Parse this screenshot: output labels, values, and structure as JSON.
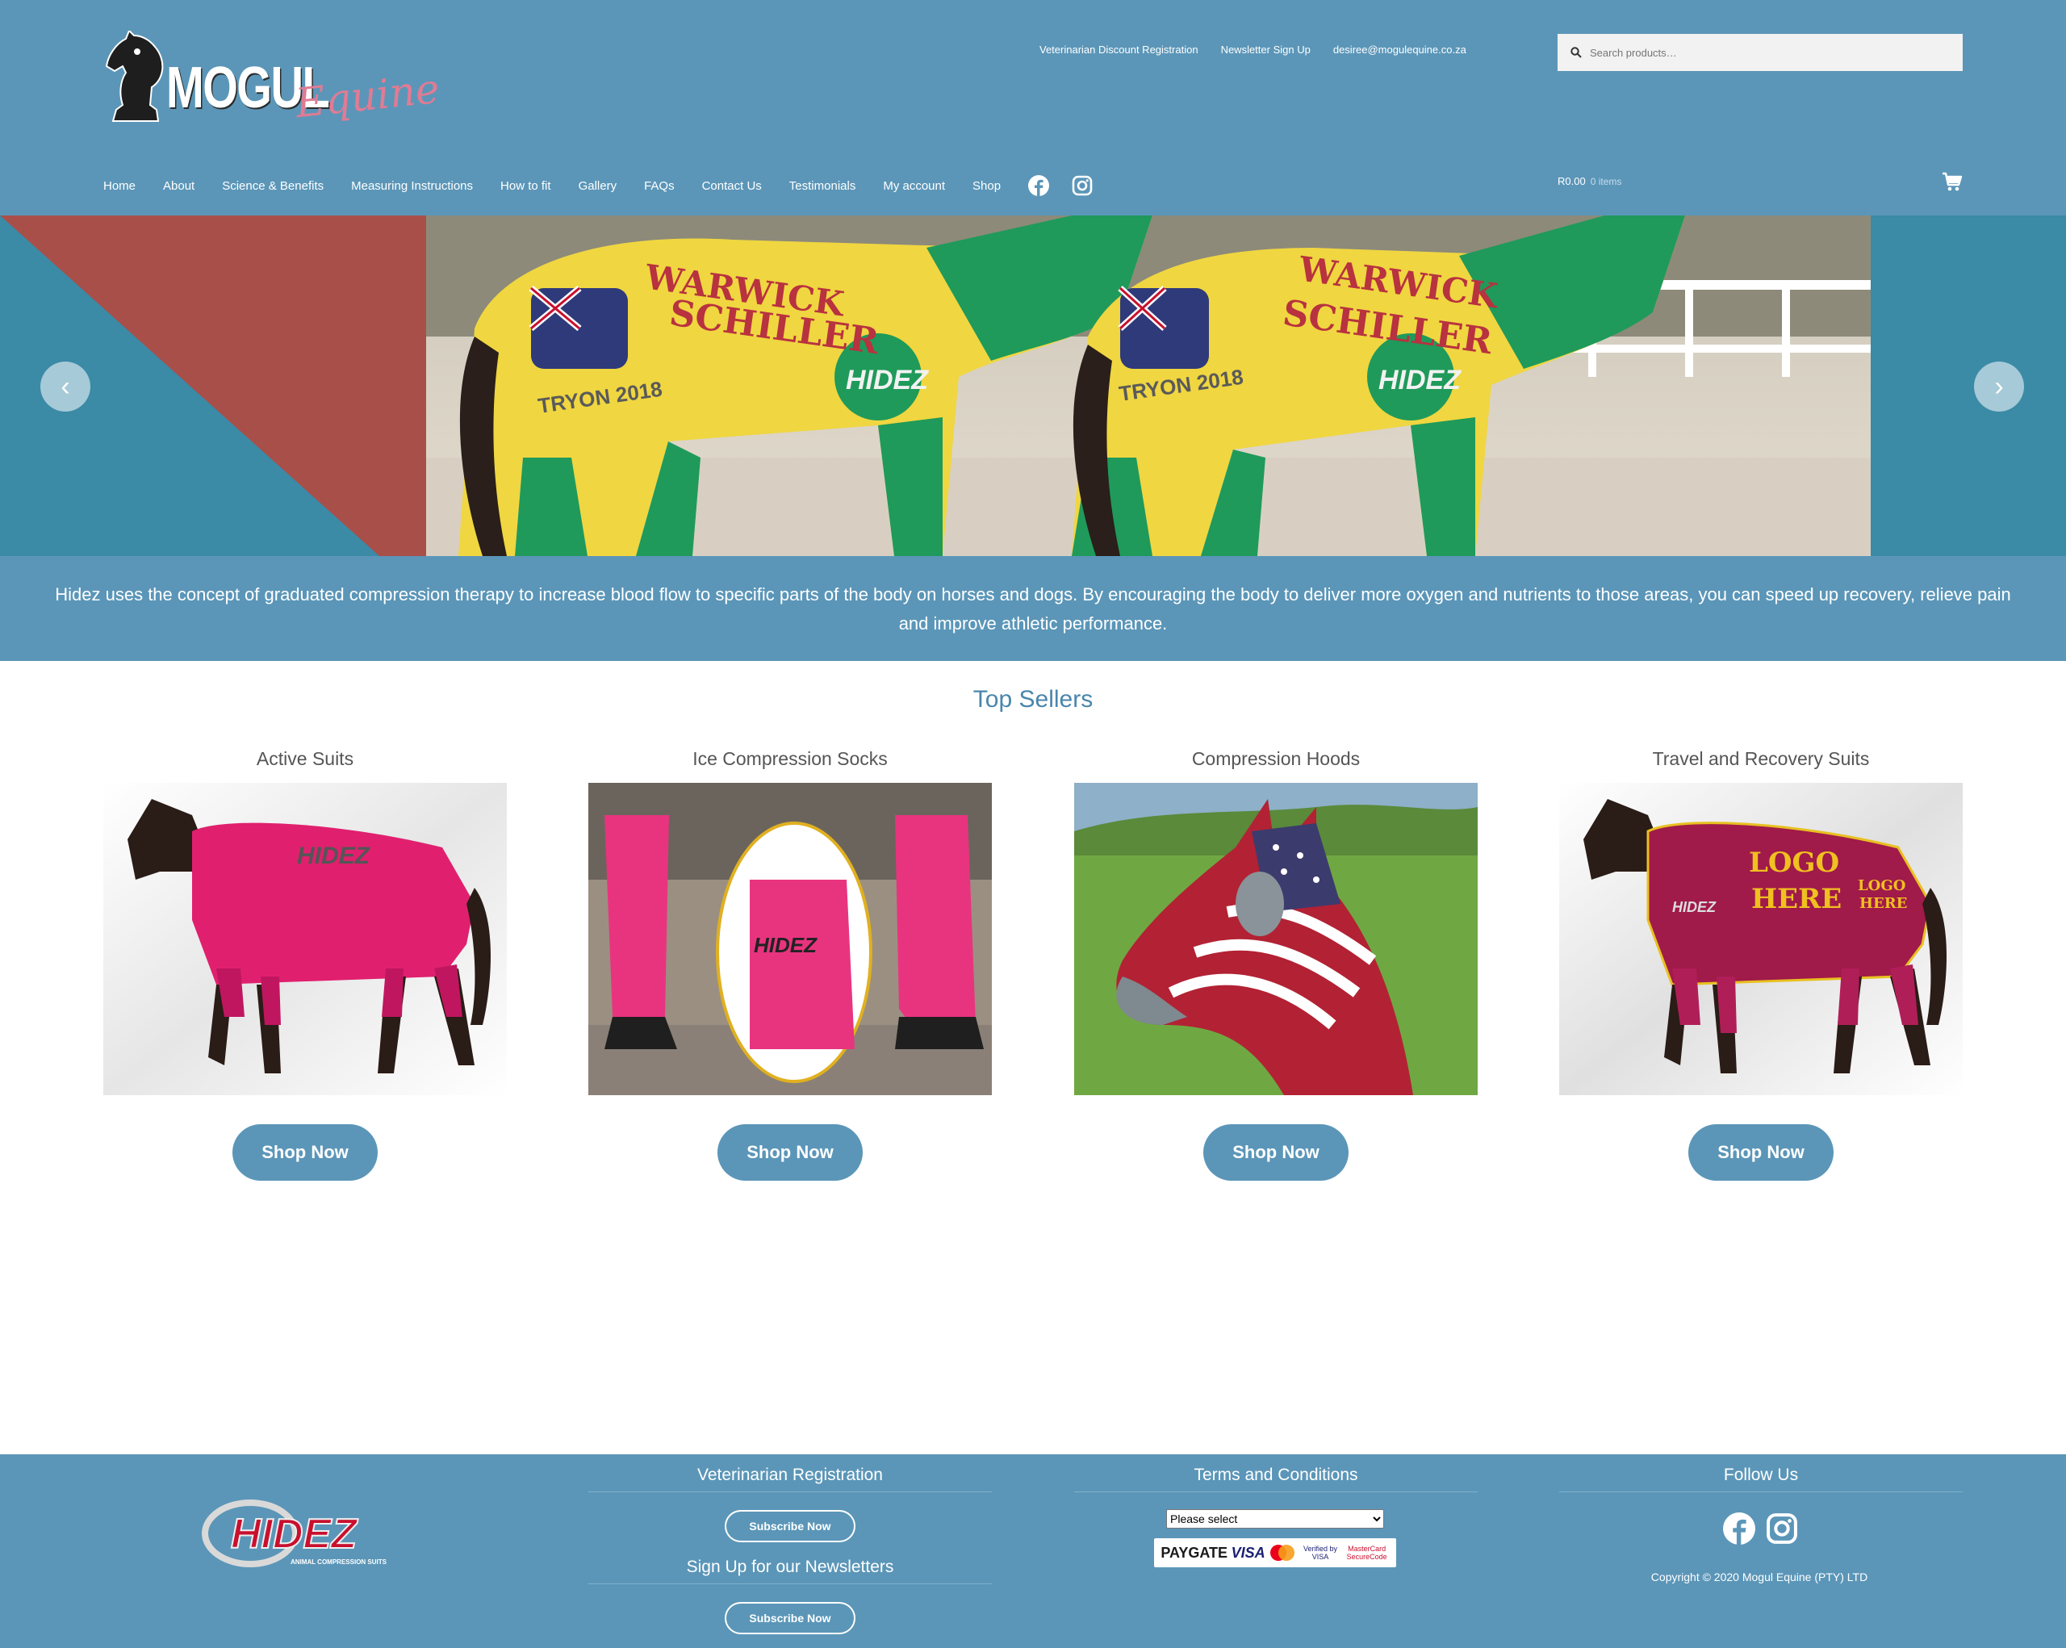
{
  "brand": {
    "logo_text": "MOGUL",
    "logo_script": "Equine"
  },
  "top_links": [
    "Veterinarian Discount Registration",
    "Newsletter Sign Up",
    "desiree@mogulequine.co.za"
  ],
  "search": {
    "placeholder": "Search products…"
  },
  "nav": {
    "items": [
      "Home",
      "About",
      "Science & Benefits",
      "Measuring Instructions",
      "How to fit",
      "Gallery",
      "FAQs",
      "Contact Us",
      "Testimonials",
      "My account",
      "Shop"
    ],
    "social_icons": [
      "facebook-icon",
      "instagram-icon"
    ]
  },
  "cart": {
    "amount": "R0.00",
    "items": "0 items",
    "icon": "cart-icon"
  },
  "hero": {
    "banner_text": [
      "WARWICK",
      "SCHILLER",
      "TRYON 2018",
      "HIDEZ"
    ],
    "prev_icon": "chevron-left-icon",
    "next_icon": "chevron-right-icon"
  },
  "intro": "Hidez uses the concept of graduated compression therapy to increase blood flow to specific parts of the body on horses and dogs. By encouraging the body to deliver more oxygen and nutrients to those areas, you can speed up recovery, relieve pain and improve athletic performance.",
  "top_sellers": {
    "title": "Top Sellers",
    "button_label": "Shop Now",
    "products": [
      {
        "name": "Active Suits",
        "color": "#e0206e"
      },
      {
        "name": "Ice Compression Socks",
        "color": "#e8347f"
      },
      {
        "name": "Compression Hoods",
        "color": "#b22234"
      },
      {
        "name": "Travel and Recovery Suits",
        "color": "#a01a4a",
        "overlay": [
          "LOGO",
          "HERE",
          "LOGO",
          "HERE"
        ]
      }
    ]
  },
  "footer": {
    "logo_text": "HIDEZ",
    "logo_tagline": "ANIMAL COMPRESSION SUITS",
    "vet_title": "Veterinarian Registration",
    "vet_button": "Subscribe Now",
    "news_title": "Sign Up for our Newsletters",
    "news_button": "Subscribe Now",
    "terms_title": "Terms and Conditions",
    "terms_select": "Please select",
    "payment": {
      "paygate": "PAYGATE",
      "visa": "VISA",
      "verified": "Verified by VISA",
      "securecode": "MasterCard SecureCode"
    },
    "follow_title": "Follow Us",
    "copyright": "Copyright © 2020 Mogul Equine (PTY) LTD"
  },
  "colors": {
    "brand_blue": "#5b96b8",
    "title_blue": "#4a86ac",
    "accent_pink": "#e07b94"
  }
}
